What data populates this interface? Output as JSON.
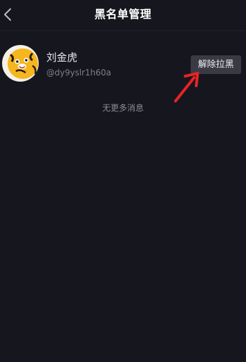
{
  "header": {
    "title": "黑名单管理",
    "back_icon": "chevron-left-icon"
  },
  "blocked_users": [
    {
      "name": "刘金虎",
      "handle": "@dy9yslr1h60a",
      "action_label": "解除拉黑"
    }
  ],
  "footer_note": "无更多消息",
  "colors": {
    "background": "#16161f",
    "button_bg": "#3a3a44",
    "annotation_arrow": "#e82424"
  }
}
